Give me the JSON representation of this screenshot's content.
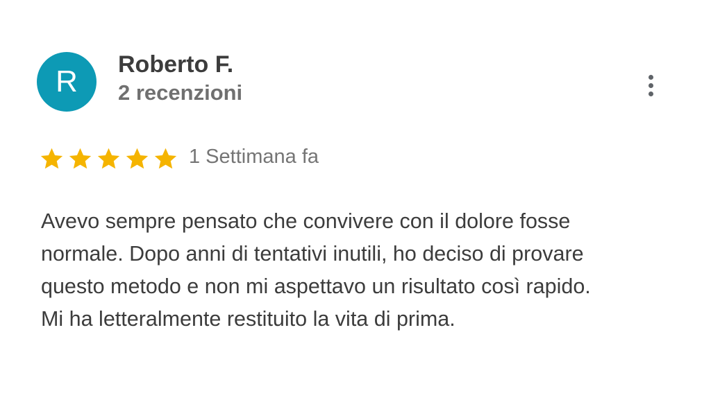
{
  "review": {
    "avatar_letter": "R",
    "author": "Roberto F.",
    "review_count": "2 recenzioni",
    "rating": 5,
    "max_rating": 5,
    "date": "1 Settimana fa",
    "text_lines": [
      "Avevo sempre pensato che convivere con il dolore fosse",
      "normale. Dopo anni di tentativi inutili, ho deciso di provare",
      "questo metodo e non mi aspettavo un risultato così rapido.",
      "Mi ha letteralmente restituito la vita di prima."
    ]
  },
  "icons": {
    "more": "more-vertical-icon",
    "star": "star-icon"
  },
  "colors": {
    "avatar_bg": "#0d9ab5",
    "star": "#f5b400",
    "name_text": "#3c3c3c",
    "meta_text": "#707070",
    "body_text": "#3c3c3c"
  }
}
